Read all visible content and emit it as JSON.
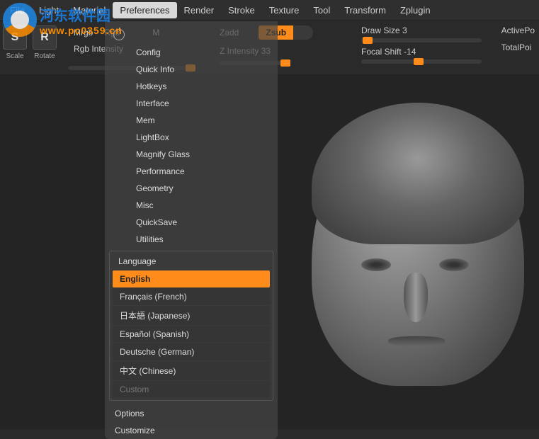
{
  "menubar": {
    "items": [
      "File",
      "Light",
      "Material",
      "Preferences",
      "Render",
      "Stroke",
      "Texture",
      "Tool",
      "Transform",
      "Zplugin"
    ],
    "active_index": 3
  },
  "toolbar": {
    "scale": {
      "icon": "S",
      "label": "Scale"
    },
    "rotate": {
      "icon": "R",
      "label": "Rotate"
    },
    "mrgb": "Mrgb",
    "rgb": "Rgb",
    "m": "M",
    "rgb_intensity": "Rgb Intensity",
    "zadd": "Zadd",
    "zsub": "Zsub",
    "z_intensity": "Z Intensity  33",
    "draw_size": "Draw Size  3",
    "focal_shift": "Focal Shift  -14",
    "active_points": "ActivePo",
    "total_points": "TotalPoi"
  },
  "preferences_menu": {
    "items": [
      "Config",
      "Quick Info",
      "Hotkeys",
      "Interface",
      "Mem",
      "LightBox",
      "Magnify Glass",
      "Performance",
      "Geometry",
      "Misc",
      "QuickSave",
      "Utilities"
    ],
    "language_header": "Language",
    "languages": [
      "English",
      "Français (French)",
      "日本語 (Japanese)",
      "Español (Spanish)",
      "Deutsche (German)",
      "中文 (Chinese)"
    ],
    "selected_language": 0,
    "custom": "Custom",
    "footer": [
      "Options",
      "Customize"
    ]
  },
  "watermark": {
    "title": "河东软件园",
    "url": "www.pc0359.cn"
  }
}
